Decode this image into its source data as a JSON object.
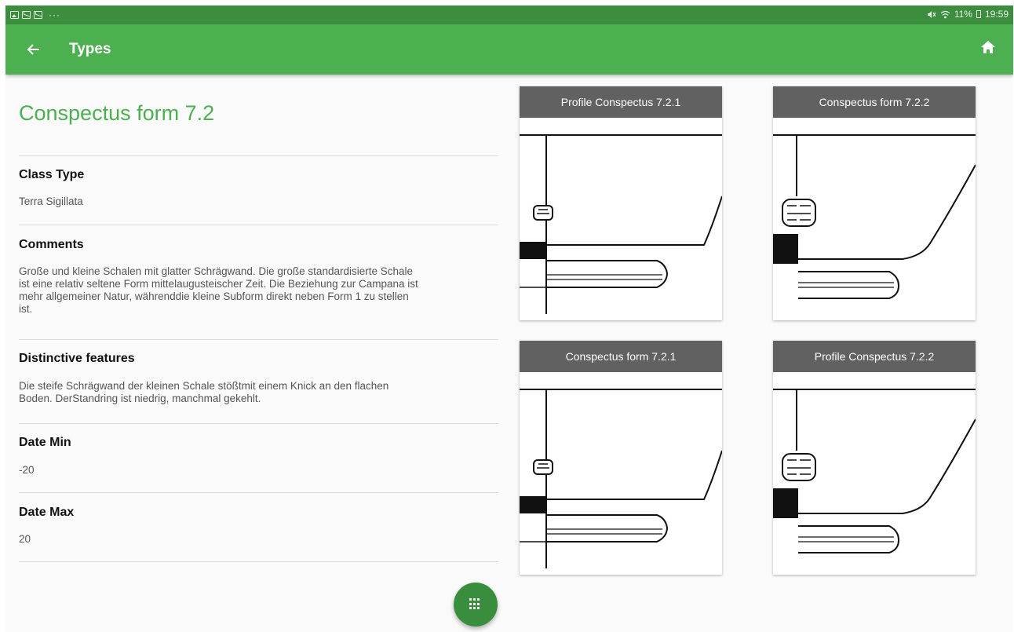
{
  "status_bar": {
    "battery": "11%",
    "time": "19:59",
    "more": "···"
  },
  "appbar": {
    "title": "Types"
  },
  "detail": {
    "title": "Conspectus form 7.2",
    "class_type_label": "Class Type",
    "class_type_value": "Terra Sigillata",
    "comments_label": "Comments",
    "comments_lines": [
      "Große und kleine Schalen mit glatter Schrägwand. Die große standardisierte Schale",
      "ist eine relativ seltene Form mittelaugusteischer Zeit. Die Beziehung zur Campana ist",
      "mehr allgemeiner Natur, währenddie kleine Subform direkt neben Form 1 zu stellen",
      "ist."
    ],
    "features_label": "Distinctive features",
    "features_lines": [
      "Die steife Schrägwand der kleinen Schale stößtmit einem Knick an den flachen",
      "Boden. DerStandring ist niedrig, manchmal gekehlt."
    ],
    "date_min_label": "Date Min",
    "date_min_value": "-20",
    "date_max_label": "Date Max",
    "date_max_value": "20"
  },
  "gallery": [
    {
      "title": "Profile Conspectus 7.2.1"
    },
    {
      "title": "Conspectus form 7.2.2"
    },
    {
      "title": "Conspectus form 7.2.1"
    },
    {
      "title": "Profile Conspectus 7.2.2"
    }
  ],
  "icons": {
    "back": "arrow-left-icon",
    "home": "home-icon",
    "fab": "grid-menu-icon"
  }
}
